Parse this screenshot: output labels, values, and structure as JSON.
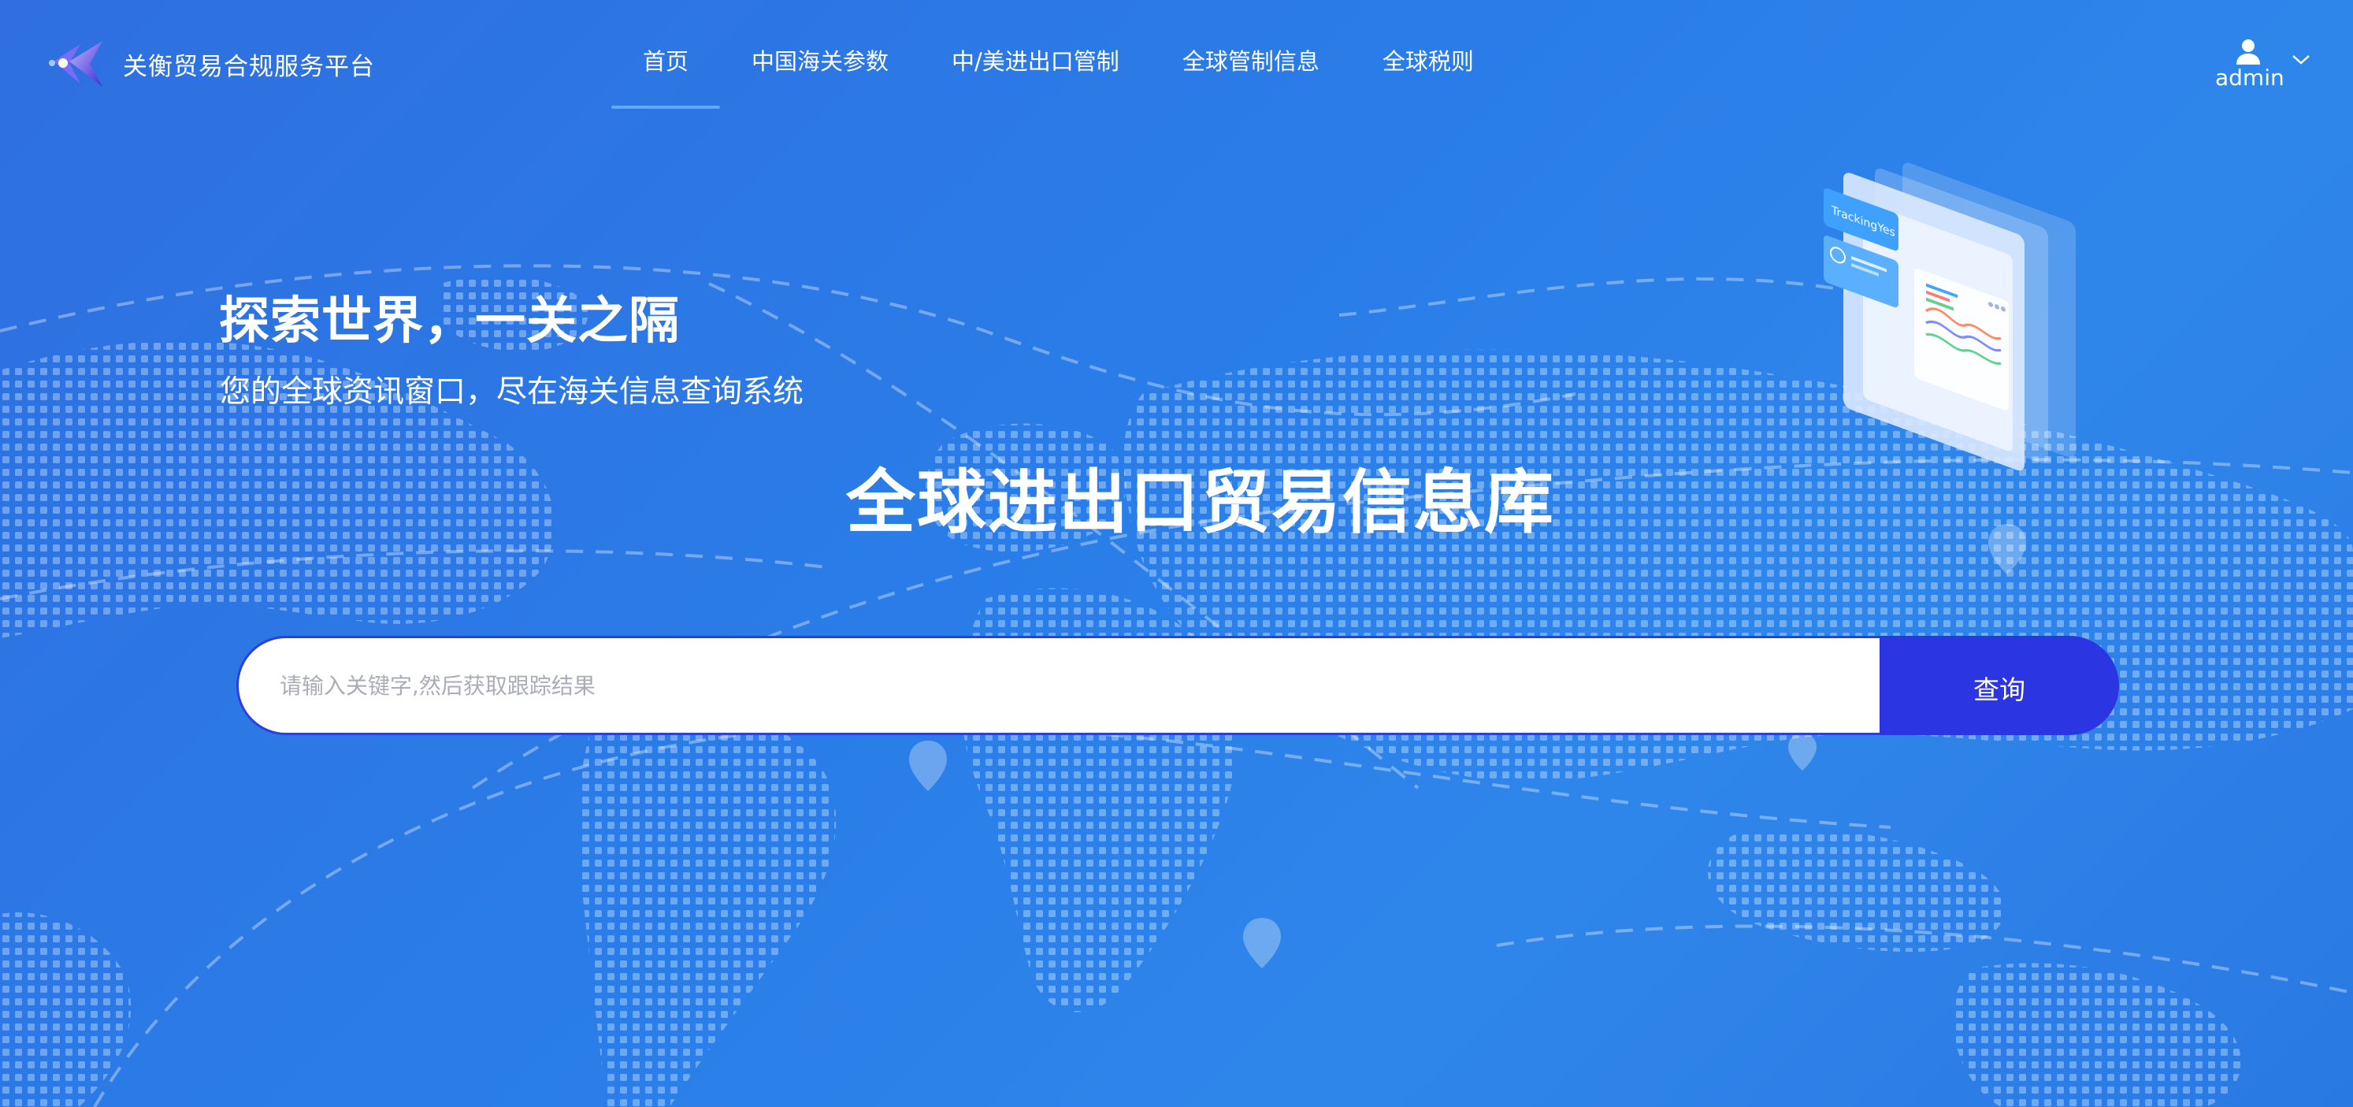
{
  "header": {
    "brand_name": "关衡贸易合规服务平台",
    "nav": [
      {
        "label": "首页",
        "active": true
      },
      {
        "label": "中国海关参数",
        "active": false
      },
      {
        "label": "中/美进出口管制",
        "active": false
      },
      {
        "label": "全球管制信息",
        "active": false
      },
      {
        "label": "全球税则",
        "active": false
      }
    ],
    "user": {
      "name": "admin",
      "icon": "user-icon",
      "menu_icon": "chevron-down-icon"
    }
  },
  "hero": {
    "title": "探索世界，一关之隔",
    "subtitle": "您的全球资讯窗口，尽在海关信息查询系统",
    "database_title": "全球进出口贸易信息库"
  },
  "search": {
    "placeholder": "请输入关键字,然后获取跟踪结果",
    "value": "",
    "button_label": "查询"
  },
  "illustration": {
    "card_label": "TrackingYes"
  },
  "colors": {
    "background": "#2a7de8",
    "search_accent": "#2b35e1",
    "nav_active_underline": "#5fa9ff",
    "text": "#ffffff"
  }
}
